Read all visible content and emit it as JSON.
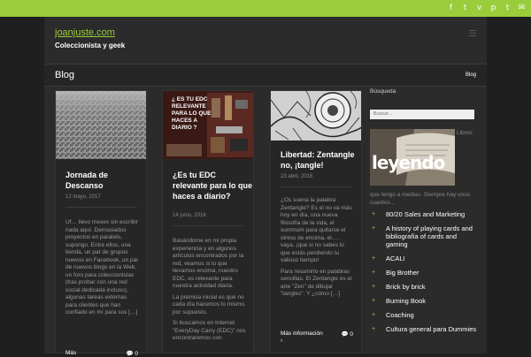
{
  "header": {
    "site_title": "joanjuste.com",
    "tagline": "Coleccionista y geek",
    "social_icons": [
      "facebook-icon",
      "twitter-icon",
      "vimeo-icon",
      "pinterest-icon",
      "tumblr-icon",
      "email-icon"
    ],
    "social_glyphs": [
      "f",
      "t",
      "v",
      "p",
      "t",
      "✉"
    ]
  },
  "page": {
    "title": "Blog",
    "breadcrumb": "Blog"
  },
  "posts": [
    {
      "title": "Jornada de Descanso",
      "date": "12 mayo, 2017",
      "excerpt": "Uf… llevo meses sin escribir nada aquí. Demasiados proyectos en paralelo, supongo. Entre ellos, una tienda, un par de grupos nuevos en Facebook, un par de nuevos blogs en la Web, un foro para coleccionistas (tras probar con una red social dedicada incluso), algunas tareas externas para clientes que han confiado en mí para sus […]",
      "more": "Más",
      "comments": "0"
    },
    {
      "title": "¿Es tu EDC relevante para lo que haces a diario?",
      "thumb_text": "¿ ES TU EDC RELEVANTE PARA LO QUE HACES A DIARIO ?",
      "date": "14 junio, 2016",
      "excerpt": [
        "Basándome en mi propia experiencia y en algunos artículos encontrados por la red, veamos si lo que llevamos encima, nuestro EDC, es relevante para nuestra actividad diaria.",
        "La premisa inicial es que no cada día hacemos lo mismo, por supuesto.",
        "Si buscamos en Internet \"EveryDay Carry (EDC)\" nos encontraremos con"
      ]
    },
    {
      "title": "Libertad: Zentangle no, ¡tangle!",
      "date": "23 abril, 2016",
      "excerpt": [
        "¿Os suena la palabra Zentangle? Es el no va más hoy en día, una nueva filosofía de la vida, el summum para quitarse el stress de encima, el…. vaya, ¡que si no sabes lo que estás perdiendo tu valioso tiempo!",
        "Para resumirlo en palabras sencillas. El Zentangle es el arte \"Zen\" de dibujar \"tangles\". Y ¿cómo […]"
      ],
      "more": "Más información ›",
      "comments": "0"
    }
  ],
  "sidebar": {
    "search_label": "Búsqueda",
    "search_placeholder": "Buscar...",
    "widget_label": "Libros",
    "widget_image_text": "leyendo",
    "widget_caption": "que tengo a medias. Siempre hay unos cuantos...",
    "categories": [
      "80/20 Sales and Marketing",
      "A history of playing cards and bibliografía of cards and gaming",
      "ACALI",
      "Big Brother",
      "Brick by brick",
      "Burning Book",
      "Coaching",
      "Cultura general para Dummies"
    ]
  },
  "colors": {
    "accent": "#9acd3b",
    "background": "#1f1f1f",
    "panel": "#2b2b2b"
  }
}
